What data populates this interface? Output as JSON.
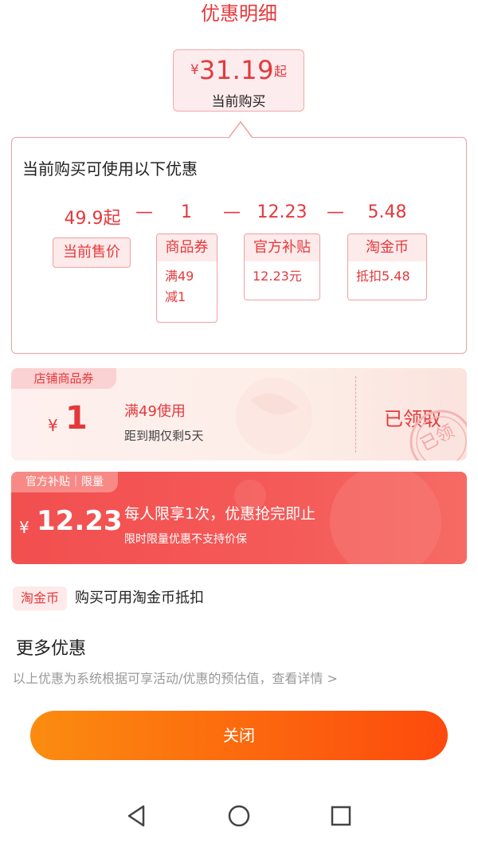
{
  "header": {
    "title": "优惠明细"
  },
  "price": {
    "currency": "¥",
    "amount": "31.19",
    "suffix": "起",
    "label": "当前购买"
  },
  "breakdown": {
    "heading": "当前购买可使用以下优惠",
    "operator": "—",
    "items": [
      {
        "value": "49.9起",
        "tag": "当前售价",
        "detail": ""
      },
      {
        "value": "1",
        "tag": "商品券",
        "detail_lines": [
          "满49",
          "减1"
        ]
      },
      {
        "value": "12.23",
        "tag": "官方补贴",
        "detail": "12.23元"
      },
      {
        "value": "5.48",
        "tag": "淘金币",
        "detail": "抵扣5.48"
      }
    ]
  },
  "coupon": {
    "tag": "店铺商品券",
    "currency": "¥",
    "amount": "1",
    "condition": "满49使用",
    "expiry": "距到期仅剩5天",
    "status": "已领取",
    "stamp": "已领"
  },
  "subsidy": {
    "tag": "官方补贴｜限量",
    "currency": "¥",
    "amount": "12.23",
    "main_text": "每人限享1次，优惠抢完即止",
    "note": "限时限量优惠不支持价保"
  },
  "taojinbi": {
    "pill": "淘金币",
    "text": "购买可用淘金币抵扣"
  },
  "more": {
    "title": "更多优惠",
    "note": "以上优惠为系统根据可享活动/优惠的预估值，查看详情 >"
  },
  "close_label": "关闭",
  "nav": [
    "back-icon",
    "home-icon",
    "recents-icon"
  ],
  "colors": {
    "accent": "#e4393c",
    "button_start": "#fb8c10",
    "button_end": "#fd4a0d",
    "subsidy_bg": "#f24f4f"
  }
}
